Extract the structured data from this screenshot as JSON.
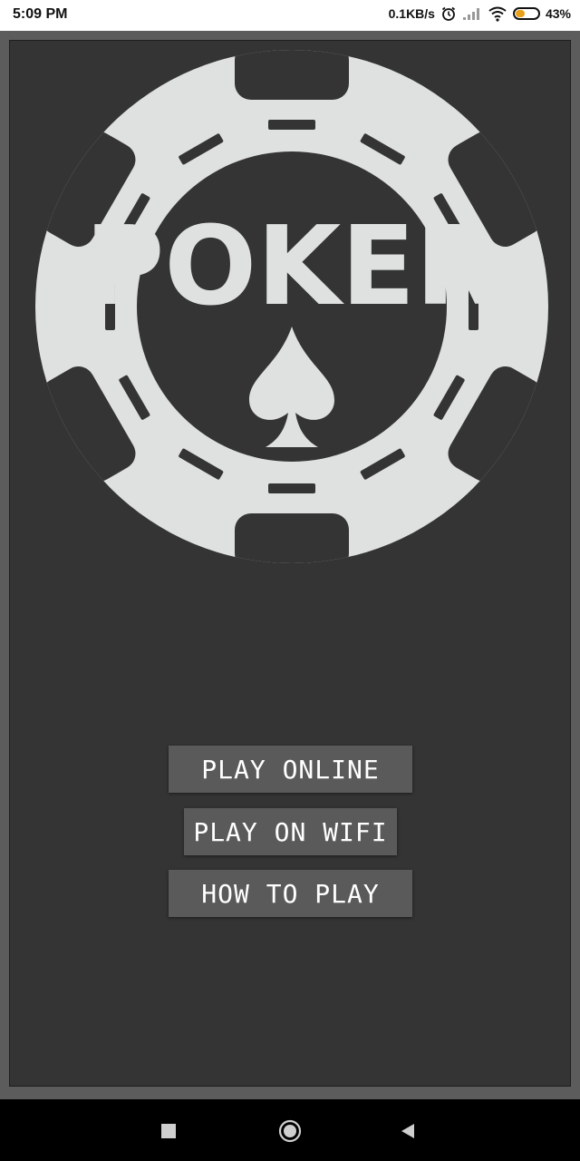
{
  "status_bar": {
    "time": "5:09 PM",
    "network_speed": "0.1KB/s",
    "battery_percent": "43%",
    "battery_level": 0.43,
    "icons": [
      "alarm-icon",
      "signal-icon",
      "wifi-icon",
      "battery-icon"
    ],
    "battery_color": "#e8a019"
  },
  "logo": {
    "title": "POKER",
    "emblem": "spade-icon",
    "chip_color": "#dfe1e1",
    "dark_color": "#343434"
  },
  "menu": {
    "play_online": "PLAY ONLINE",
    "play_on_wifi": "PLAY ON WIFI",
    "how_to_play": "HOW TO PLAY"
  },
  "nav_bar": {
    "buttons": [
      "recents-square-icon",
      "home-circle-icon",
      "back-triangle-icon"
    ]
  }
}
